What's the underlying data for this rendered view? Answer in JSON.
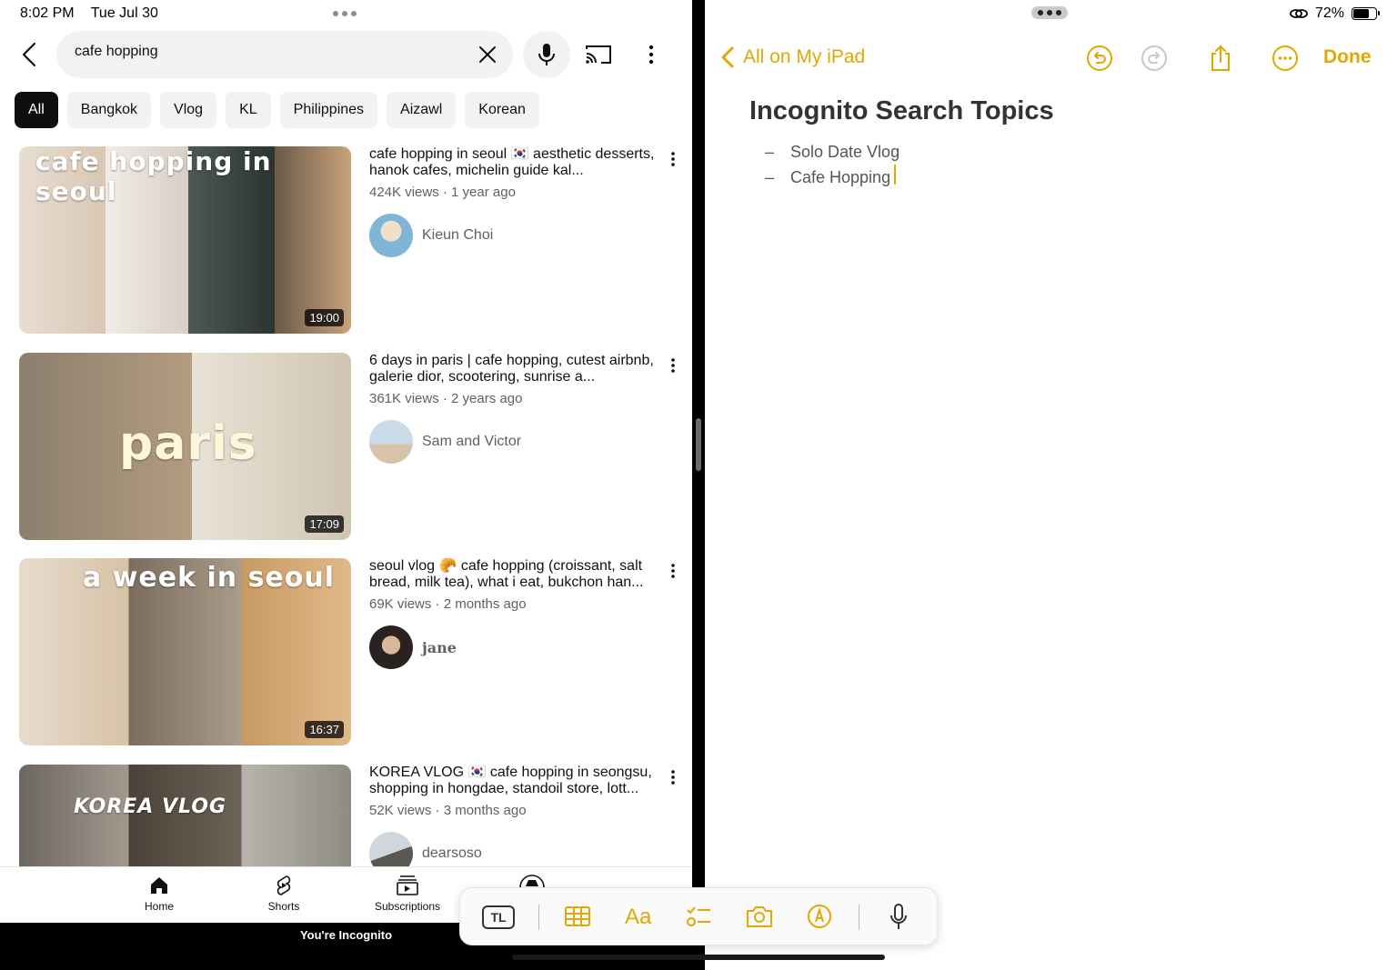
{
  "status": {
    "time": "8:02 PM",
    "date": "Tue Jul 30",
    "battery": "72%"
  },
  "youtube": {
    "search_value": "cafe hopping",
    "chips": [
      "All",
      "Bangkok",
      "Vlog",
      "KL",
      "Philippines",
      "Aizawl",
      "Korean"
    ],
    "videos": [
      {
        "title": "cafe hopping in seoul 🇰🇷 aesthetic desserts, hanok cafes, michelin guide kal...",
        "meta": "424K views · 1 year ago",
        "channel": "Kieun Choi",
        "duration": "19:00",
        "overlay": "cafe hopping in seoul"
      },
      {
        "title": "6 days in paris | cafe hopping, cutest airbnb, galerie dior, scootering, sunrise a...",
        "meta": "361K views · 2 years ago",
        "channel": "Sam and Victor",
        "duration": "17:09",
        "overlay": "paris"
      },
      {
        "title": "seoul vlog 🥐 cafe hopping (croissant, salt bread, milk tea), what i eat, bukchon han...",
        "meta": "69K views · 2 months ago",
        "channel": "jane",
        "duration": "16:37",
        "overlay": "a week in seoul"
      },
      {
        "title": "KOREA VLOG 🇰🇷 cafe hopping in seongsu, shopping in hongdae, standoil store, lott...",
        "meta": "52K views · 3 months ago",
        "channel": "dearsoso",
        "duration": "",
        "overlay": "KOREA VLOG"
      }
    ],
    "nav": {
      "home": "Home",
      "shorts": "Shorts",
      "subscriptions": "Subscriptions"
    },
    "incognito": "You're Incognito"
  },
  "notes": {
    "back_label": "All on My iPad",
    "done_label": "Done",
    "title": "Incognito Search Topics",
    "items": [
      "Solo Date Vlog",
      "Cafe Hopping"
    ],
    "format_bar": {
      "table_label": "TL",
      "text_label": "Aa"
    }
  },
  "colors": {
    "accent": "#e0a800",
    "chip_active": "#0f0f0f",
    "chip_bg": "#f2f2f2"
  }
}
